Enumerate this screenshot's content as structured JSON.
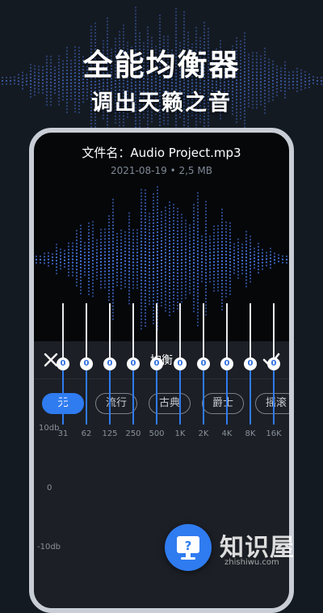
{
  "headline": {
    "title": "全能均衡器",
    "subtitle": "调出天籁之音"
  },
  "file": {
    "name": "文件名：Audio Project.mp3",
    "meta": "2021-08-19 • 2,5 MB"
  },
  "equalizer": {
    "title": "均衡",
    "presets": [
      {
        "label": "无",
        "active": true
      },
      {
        "label": "流行",
        "active": false
      },
      {
        "label": "古典",
        "active": false
      },
      {
        "label": "爵士",
        "active": false
      },
      {
        "label": "摇滚",
        "active": false
      }
    ],
    "db_max": "10db",
    "db_zero": "0",
    "db_min": "-10db",
    "bands": [
      {
        "freq": "31",
        "value": "0"
      },
      {
        "freq": "62",
        "value": "0"
      },
      {
        "freq": "125",
        "value": "0"
      },
      {
        "freq": "250",
        "value": "0"
      },
      {
        "freq": "500",
        "value": "0"
      },
      {
        "freq": "1K",
        "value": "0"
      },
      {
        "freq": "2K",
        "value": "0"
      },
      {
        "freq": "4K",
        "value": "0"
      },
      {
        "freq": "8K",
        "value": "0"
      },
      {
        "freq": "16K",
        "value": "0"
      }
    ]
  },
  "watermark": {
    "text": "知识屋",
    "url": "zhishiwu.com"
  },
  "colors": {
    "accent": "#2f7bf0",
    "background": "#141a22",
    "wave": "#4c7ef0"
  }
}
